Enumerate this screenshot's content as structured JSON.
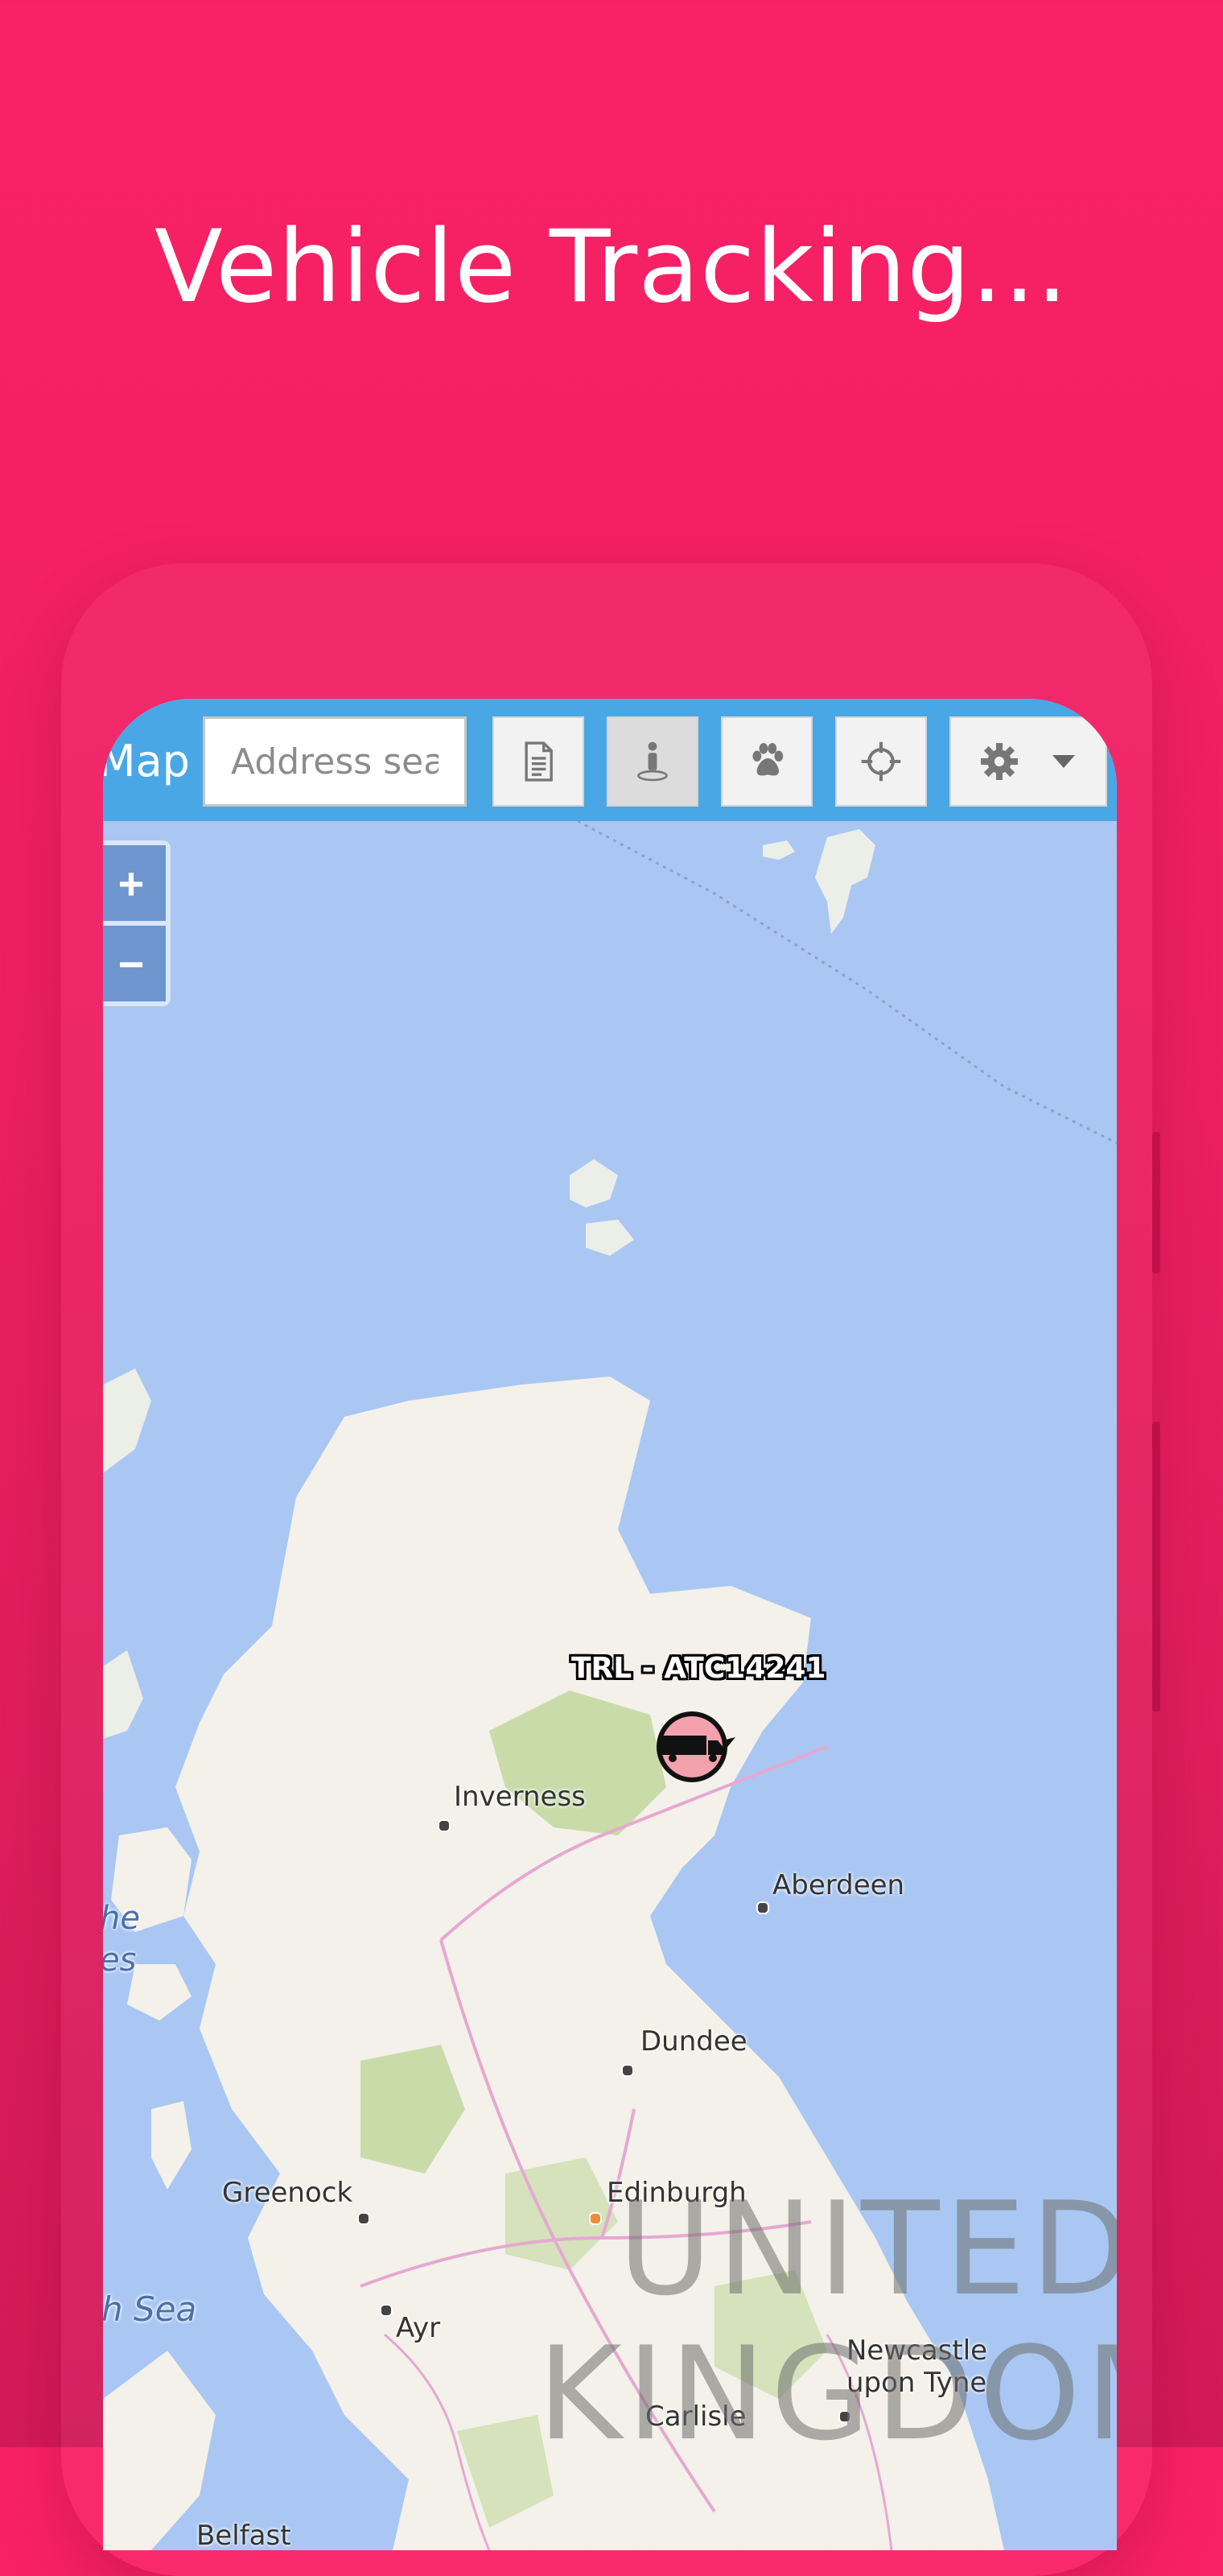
{
  "promo": {
    "headline": "Vehicle Tracking..."
  },
  "toolbar": {
    "title": "Map",
    "search_placeholder": "Address sea",
    "buttons": [
      "document-icon",
      "person-pin-icon",
      "paw-icon",
      "crosshair-icon",
      "gear-icon"
    ],
    "active_button": "person-pin-icon"
  },
  "map": {
    "zoom_in": "+",
    "zoom_out": "−",
    "places": {
      "inverness": "Inverness",
      "aberdeen": "Aberdeen",
      "dundee": "Dundee",
      "greenock": "Greenock",
      "edinburgh": "Edinburgh",
      "ayr": "Ayr",
      "carlisle": "Carlisle",
      "newcastle_1": "Newcastle",
      "newcastle_2": "upon Tyne",
      "belfast": "Belfast",
      "the_hebrides_1": "he",
      "the_hebrides_2": "es",
      "irish_sea": "h Sea",
      "uk_1": "UNITED",
      "uk_2": "KINGDOM"
    },
    "vehicle": {
      "label": "TRL - ATC14241",
      "color": "#f3a1ad"
    }
  },
  "colors": {
    "background": "#f92166",
    "toolbar": "#4aa7e6",
    "sea": "#a9c7f2",
    "land": "#f3f1ea"
  }
}
